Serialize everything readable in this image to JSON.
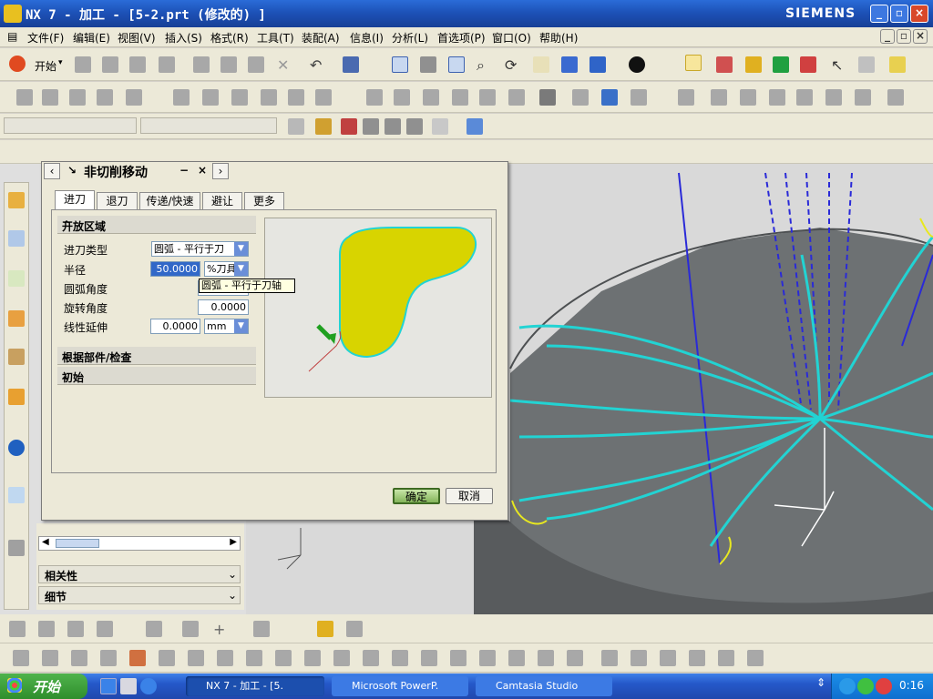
{
  "window": {
    "title": "NX 7 - 加工 - [5-2.prt (修改的) ]",
    "brand": "SIEMENS"
  },
  "menu": [
    "文件(F)",
    "编辑(E)",
    "视图(V)",
    "插入(S)",
    "格式(R)",
    "工具(T)",
    "装配(A)",
    "信息(I)",
    "分析(L)",
    "首选项(P)",
    "窗口(O)",
    "帮助(H)"
  ],
  "toolbar": {
    "start_label": "开始"
  },
  "dialog": {
    "title": "非切削移动",
    "tabs": [
      "进刀",
      "退刀",
      "传递/快速",
      "避让",
      "更多"
    ],
    "active_tab": "进刀",
    "sections": {
      "open_area": "开放区域",
      "by_part": "根据部件/检查",
      "initial": "初始"
    },
    "fields": {
      "engage_type": {
        "label": "进刀类型",
        "value": "圆弧 - 平行于刀"
      },
      "radius": {
        "label": "半径",
        "value": "50.0000",
        "unit": "%刀具"
      },
      "arc_angle": {
        "label": "圆弧角度",
        "value": ""
      },
      "rotation_angle": {
        "label": "旋转角度",
        "value": "0.0000"
      },
      "linear_ext": {
        "label": "线性延伸",
        "value": "0.0000",
        "unit": "mm"
      }
    },
    "tooltip": "圆弧 - 平行于刀轴",
    "ok": "确定",
    "cancel": "取消"
  },
  "navigator": {
    "related": "相关性",
    "details": "细节"
  },
  "taskbar": {
    "start": "开始",
    "tasks": [
      "NX 7 - 加工 - [5.",
      "Microsoft PowerP.",
      "Camtasia Studio"
    ],
    "clock": "0:16"
  },
  "colors": {
    "toolpath": "#22d3d3",
    "engage": "#e8e820",
    "retract": "#2a2ad8",
    "part": "#6a6e70",
    "preview_shape": "#d8d400"
  }
}
